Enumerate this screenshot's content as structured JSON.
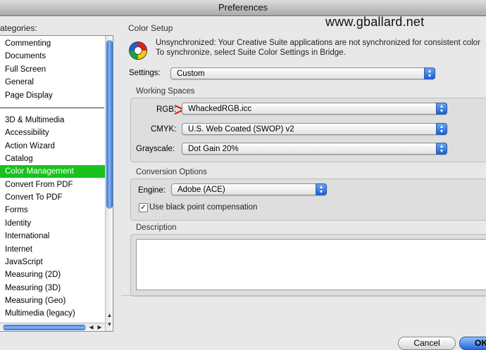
{
  "window": {
    "title": "Preferences"
  },
  "watermark": "www.gballard.net",
  "categories": {
    "label": "ategories:",
    "top_items": [
      "Commenting",
      "Documents",
      "Full Screen",
      "General",
      "Page Display"
    ],
    "items": [
      "3D & Multimedia",
      "Accessibility",
      "Action Wizard",
      "Catalog",
      "Color Management",
      "Convert From PDF",
      "Convert To PDF",
      "Forms",
      "Identity",
      "International",
      "Internet",
      "JavaScript",
      "Measuring (2D)",
      "Measuring (3D)",
      "Measuring (Geo)",
      "Multimedia (legacy)"
    ],
    "selected": "Color Management"
  },
  "color_setup": {
    "title": "Color Setup",
    "sync_line1": "Unsynchronized: Your Creative Suite applications are not synchronized for consistent color",
    "sync_line2": "To synchronize, select Suite Color Settings in Bridge.",
    "settings_label": "Settings:",
    "settings_value": "Custom"
  },
  "working_spaces": {
    "title": "Working Spaces",
    "rgb_label": "RGB:",
    "rgb_value": "WhackedRGB.icc",
    "cmyk_label": "CMYK:",
    "cmyk_value": "U.S. Web Coated (SWOP) v2",
    "gray_label": "Grayscale:",
    "gray_value": "Dot Gain 20%"
  },
  "conversion": {
    "title": "Conversion Options",
    "engine_label": "Engine:",
    "engine_value": "Adobe (ACE)",
    "bpc_label": "Use black point compensation",
    "bpc_checked": true
  },
  "description": {
    "title": "Description"
  },
  "buttons": {
    "cancel": "Cancel",
    "ok": "OK"
  },
  "colors": {
    "selection": "#19c11d",
    "annotation_arrow": "#e01010",
    "accent": "#1b5fd6"
  },
  "icons": {
    "sync": "color-sync-icon",
    "stepper": "popup-stepper-icon",
    "check": "checkmark-icon"
  }
}
